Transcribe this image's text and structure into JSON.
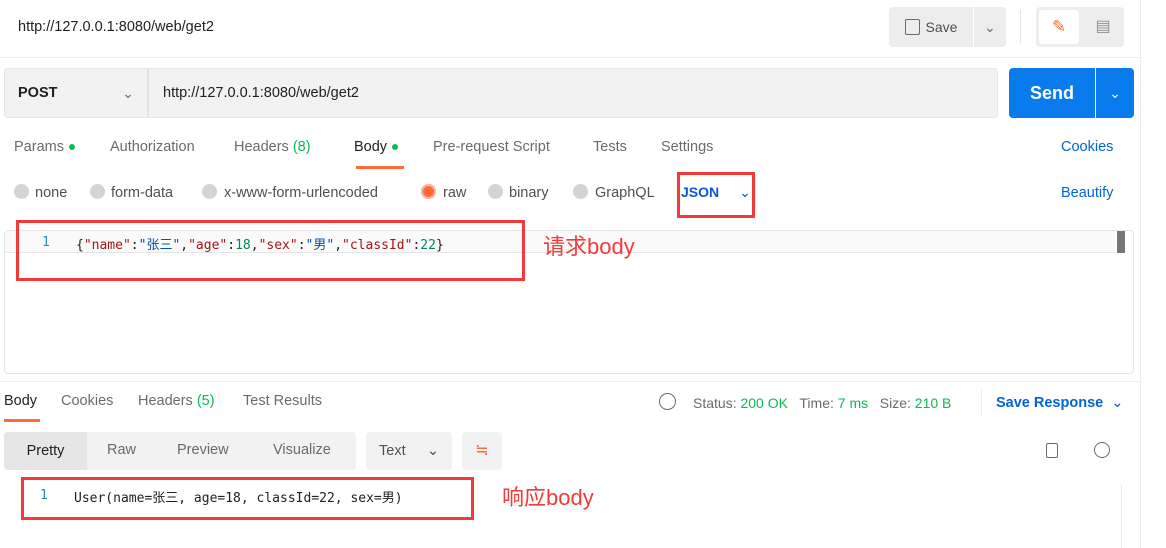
{
  "header": {
    "title": "http://127.0.0.1:8080/web/get2",
    "save_label": "Save"
  },
  "request": {
    "method": "POST",
    "url": "http://127.0.0.1:8080/web/get2",
    "send_label": "Send"
  },
  "tabs": [
    {
      "label": "Params"
    },
    {
      "label": "Authorization"
    },
    {
      "label": "Headers",
      "count": "(8)"
    },
    {
      "label": "Body"
    },
    {
      "label": "Pre-request Script"
    },
    {
      "label": "Tests"
    },
    {
      "label": "Settings"
    }
  ],
  "cookies_label": "Cookies",
  "body_types": [
    "none",
    "form-data",
    "x-www-form-urlencoded",
    "raw",
    "binary",
    "GraphQL"
  ],
  "body_format": "JSON",
  "beautify_label": "Beautify",
  "request_body": {
    "line": "1",
    "tokens": [
      "{",
      "\"name\"",
      ":",
      "\"张三\"",
      ",",
      "\"age\"",
      ":",
      "18",
      ",",
      "\"sex\"",
      ":",
      "\"男\"",
      ",",
      "\"classId\"",
      ":",
      "22",
      "}"
    ]
  },
  "annotations": {
    "request": "请求body",
    "response": "响应body"
  },
  "response": {
    "tabs": [
      {
        "label": "Body"
      },
      {
        "label": "Cookies"
      },
      {
        "label": "Headers",
        "count": "(5)"
      },
      {
        "label": "Test Results"
      }
    ],
    "status_label": "Status:",
    "status": "200 OK",
    "time_label": "Time:",
    "time": "7 ms",
    "size_label": "Size:",
    "size": "210 B",
    "save_response": "Save Response",
    "view_modes": [
      "Pretty",
      "Raw",
      "Preview",
      "Visualize"
    ],
    "format": "Text",
    "line": "1",
    "body": "User(name=张三, age=18, classId=22, sex=男)"
  },
  "colors": {
    "accent": "#ff6c37",
    "send": "#097bed",
    "link": "#0265d2",
    "ok": "#0cbb52",
    "annotation": "#f23a3a"
  }
}
